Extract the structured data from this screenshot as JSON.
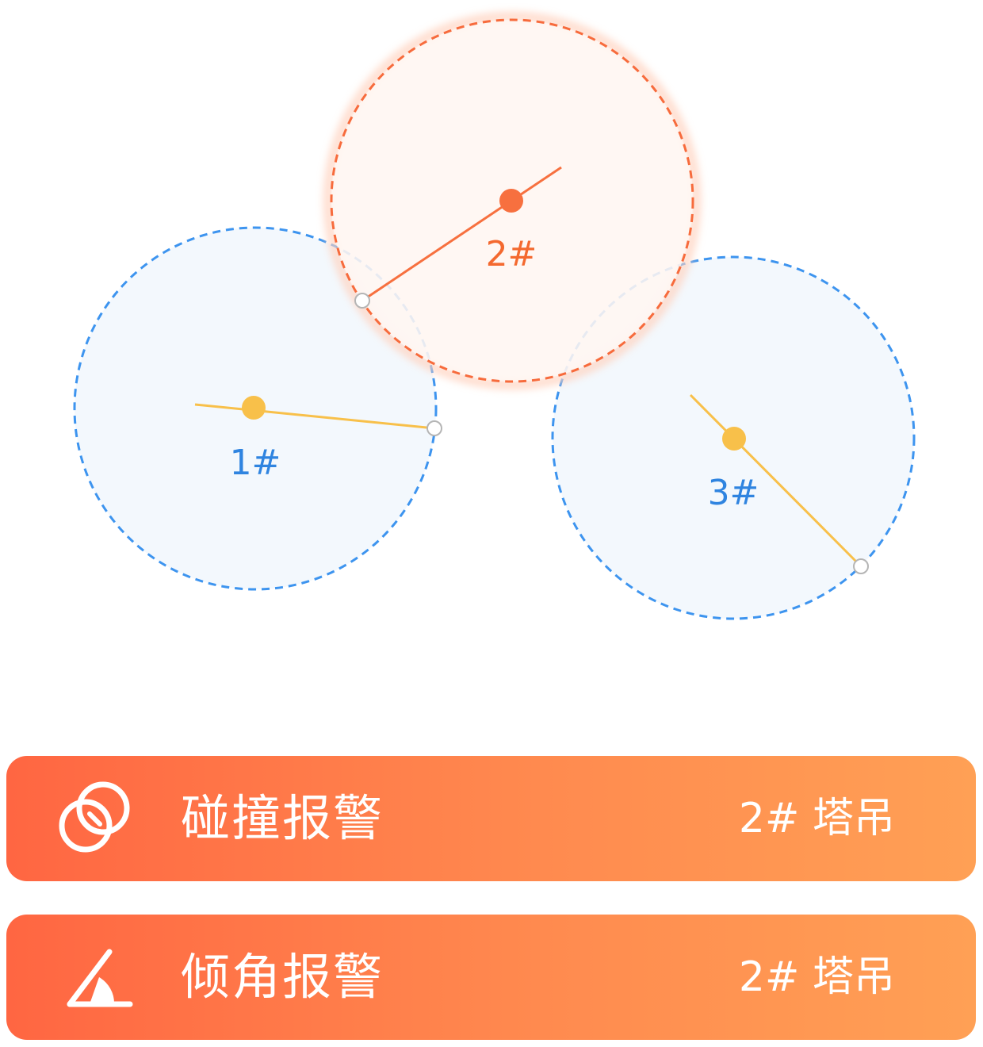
{
  "cranes": [
    {
      "id": "crane-1",
      "label": "1#",
      "status": "normal"
    },
    {
      "id": "crane-2",
      "label": "2#",
      "status": "alarm"
    },
    {
      "id": "crane-3",
      "label": "3#",
      "status": "normal"
    }
  ],
  "colors": {
    "normal_ring": "#3d94ef",
    "normal_fill": "#f3f8fd",
    "normal_arm": "#f8c04a",
    "normal_label": "#2f84e0",
    "alarm_ring": "#f76b3c",
    "alarm_fill": "#fff6f1",
    "alarm_arm": "#f7703f",
    "alarm_label": "#f4692f",
    "banner_start": "#ff6642",
    "banner_end": "#ffa055"
  },
  "alarms": [
    {
      "icon": "collision-rings-icon",
      "title": "碰撞报警",
      "target": "2# 塔吊"
    },
    {
      "icon": "tilt-angle-icon",
      "title": "倾角报警",
      "target": "2# 塔吊"
    }
  ]
}
